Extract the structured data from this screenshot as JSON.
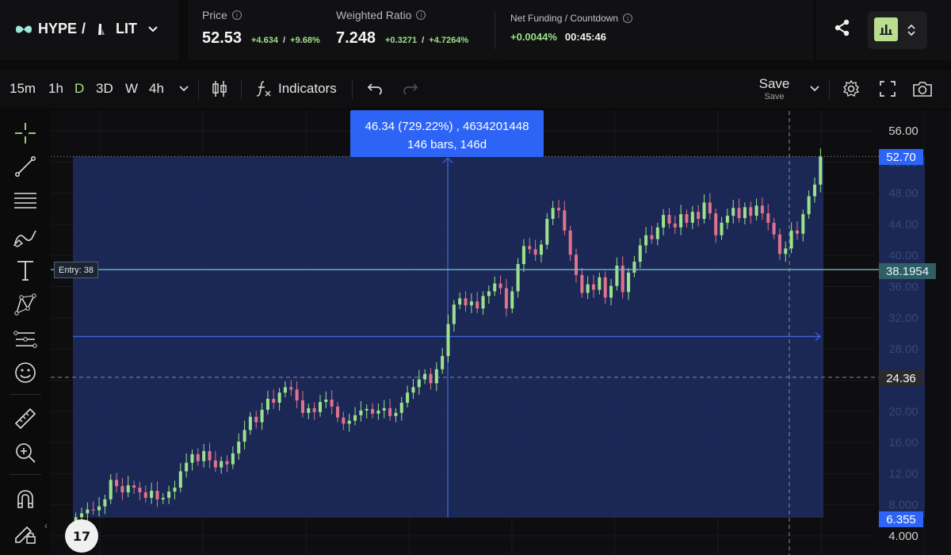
{
  "header": {
    "pair": {
      "base": "HYPE",
      "separator": "/",
      "quote": "LIT"
    },
    "price": {
      "label": "Price",
      "value": "52.53",
      "change_abs": "+4.634",
      "divider": "/",
      "change_pct": "+9.68%"
    },
    "weighted_ratio": {
      "label": "Weighted Ratio",
      "value": "7.248",
      "change_abs": "+0.3271",
      "divider": "/",
      "change_pct": "+4.7264%"
    },
    "net_funding": {
      "label": "Net Funding / Countdown",
      "rate": "+0.0044%",
      "countdown": "00:45:46"
    }
  },
  "toolbar": {
    "timeframes": [
      "15m",
      "1h",
      "D",
      "3D",
      "W",
      "4h"
    ],
    "active_timeframe": "D",
    "indicators_label": "Indicators",
    "save_label": "Save",
    "save_sub_label": "Save"
  },
  "chart": {
    "measurement": {
      "line1": "46.34 (729.22%) , 4634201448",
      "line2": "146 bars, 146d"
    },
    "entry_label": "Entry: 38",
    "price_tags": {
      "current": "52.70",
      "entry": "38.1954",
      "crosshair": "24.36",
      "range_low": "6.355"
    },
    "logo_text": "17"
  },
  "chart_data": {
    "type": "candlestick",
    "title": "",
    "y_ticks": [
      "56.00",
      "52.00",
      "48.00",
      "44.00",
      "40.00",
      "36.00",
      "32.00",
      "28.00",
      "24.00",
      "20.00",
      "16.00",
      "12.00",
      "8.000",
      "4.000"
    ],
    "ylim": [
      4,
      56
    ],
    "grid": true,
    "colors": {
      "up": "#9be28a",
      "down": "#e0728c",
      "range_fill": "#1d2d63",
      "entry_line": "#7fc6cf",
      "range_line": "#3e63d8"
    },
    "levels": {
      "current": 52.7,
      "entry": 38.1954,
      "crosshair": 24.36,
      "range_low": 6.355,
      "range_high": 52.7,
      "mid": 29.6
    },
    "closes": [
      6.4,
      6.9,
      7.4,
      7.3,
      7.8,
      8.7,
      11.2,
      10.4,
      9.6,
      10.5,
      10.2,
      9.6,
      8.9,
      9.8,
      8.7,
      8.9,
      9.7,
      10.2,
      12.3,
      13.4,
      14.5,
      13.6,
      14.9,
      13.7,
      12.8,
      13.6,
      13.2,
      14.6,
      16.1,
      17.6,
      19.3,
      18.6,
      20.2,
      21.6,
      21.1,
      22.4,
      23.1,
      22.8,
      21.4,
      19.8,
      20.4,
      19.9,
      21.2,
      21.5,
      20.6,
      19.2,
      18.4,
      18.8,
      19.5,
      20.1,
      20.3,
      19.7,
      20.1,
      20.4,
      19.4,
      19.8,
      21.1,
      22.4,
      23.1,
      24.1,
      24.8,
      23.6,
      25.4,
      27.1,
      31.2,
      33.7,
      34.5,
      33.6,
      34.1,
      33.2,
      34.8,
      35.4,
      36.4,
      35.8,
      33.2,
      35.4,
      38.9,
      41.2,
      40.8,
      40.1,
      41.4,
      44.7,
      46.1,
      45.8,
      43.2,
      40.1,
      37.5,
      35.2,
      36.3,
      35.6,
      37.2,
      34.6,
      36.1,
      38.7,
      35.3,
      37.8,
      39.2,
      41.3,
      42.6,
      42.1,
      43.6,
      45.2,
      44.1,
      43.6,
      45.3,
      44.2,
      45.6,
      44.7,
      46.8,
      45.4,
      42.6,
      44.2,
      45.1,
      46.1,
      44.8,
      46.2,
      45.1,
      46.4,
      45.4,
      44.2,
      42.7,
      40.2,
      40.9,
      43.2,
      42.8,
      45.3,
      47.6,
      49.1,
      52.7
    ]
  }
}
